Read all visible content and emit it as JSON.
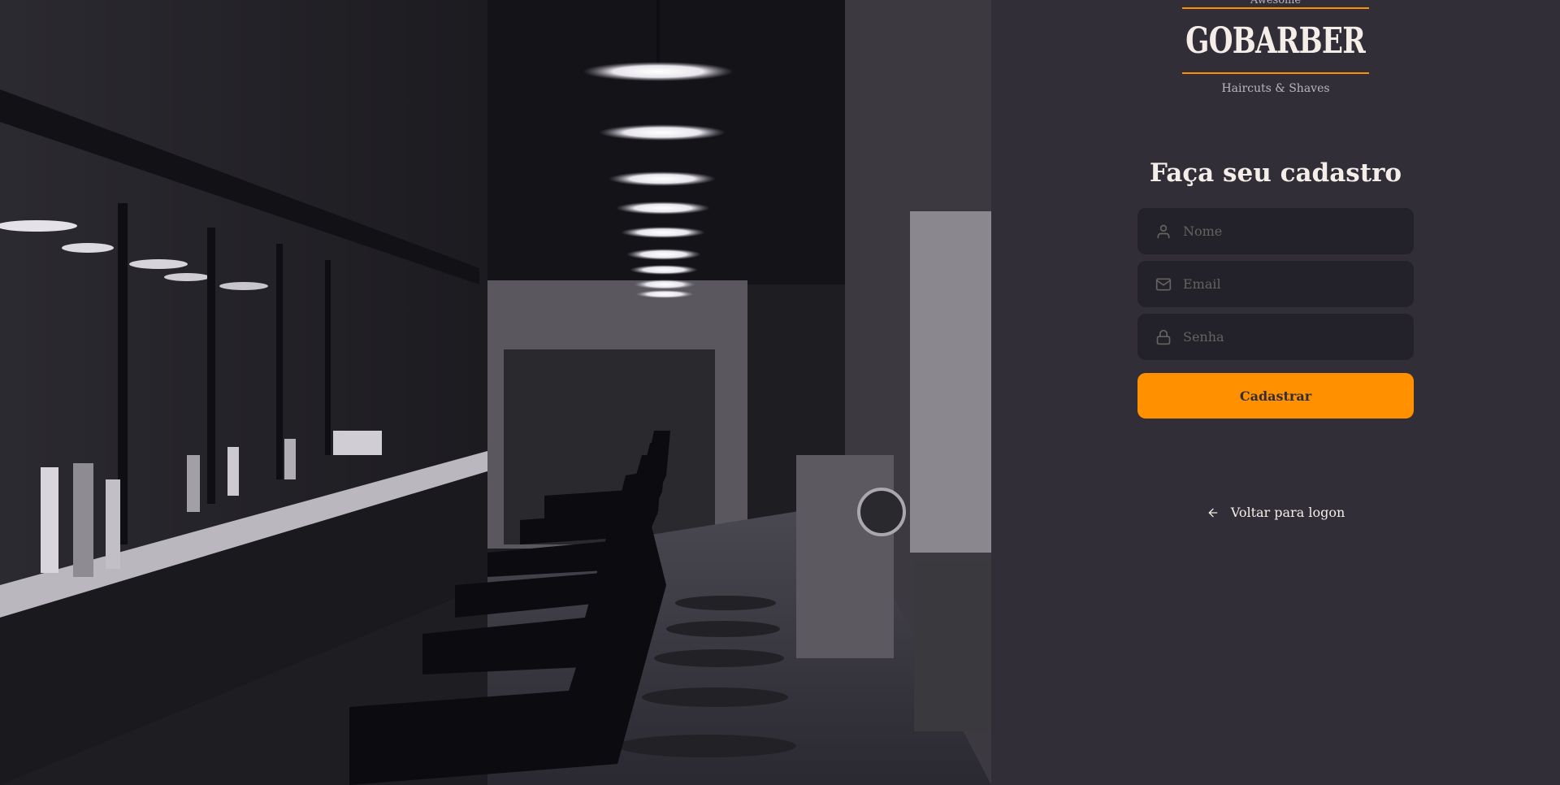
{
  "logo": {
    "top_text": "Awesome",
    "name": "GOBARBER",
    "subtitle": "Haircuts & Shaves",
    "accent_color": "#ff9000"
  },
  "background_image": {
    "icon": "barbershop-photo"
  },
  "form": {
    "title": "Faça seu cadastro",
    "fields": [
      {
        "icon": "user-icon",
        "placeholder": "Nome",
        "value": ""
      },
      {
        "icon": "mail-icon",
        "placeholder": "Email",
        "value": ""
      },
      {
        "icon": "lock-icon",
        "placeholder": "Senha",
        "value": ""
      }
    ],
    "submit_label": "Cadastrar"
  },
  "back_link": {
    "icon": "arrow-left-icon",
    "label": "Voltar para logon"
  },
  "colors": {
    "background": "#312e38",
    "input_background": "#232129",
    "primary": "#ff9000",
    "text": "#f4ede8",
    "placeholder": "#666360"
  }
}
